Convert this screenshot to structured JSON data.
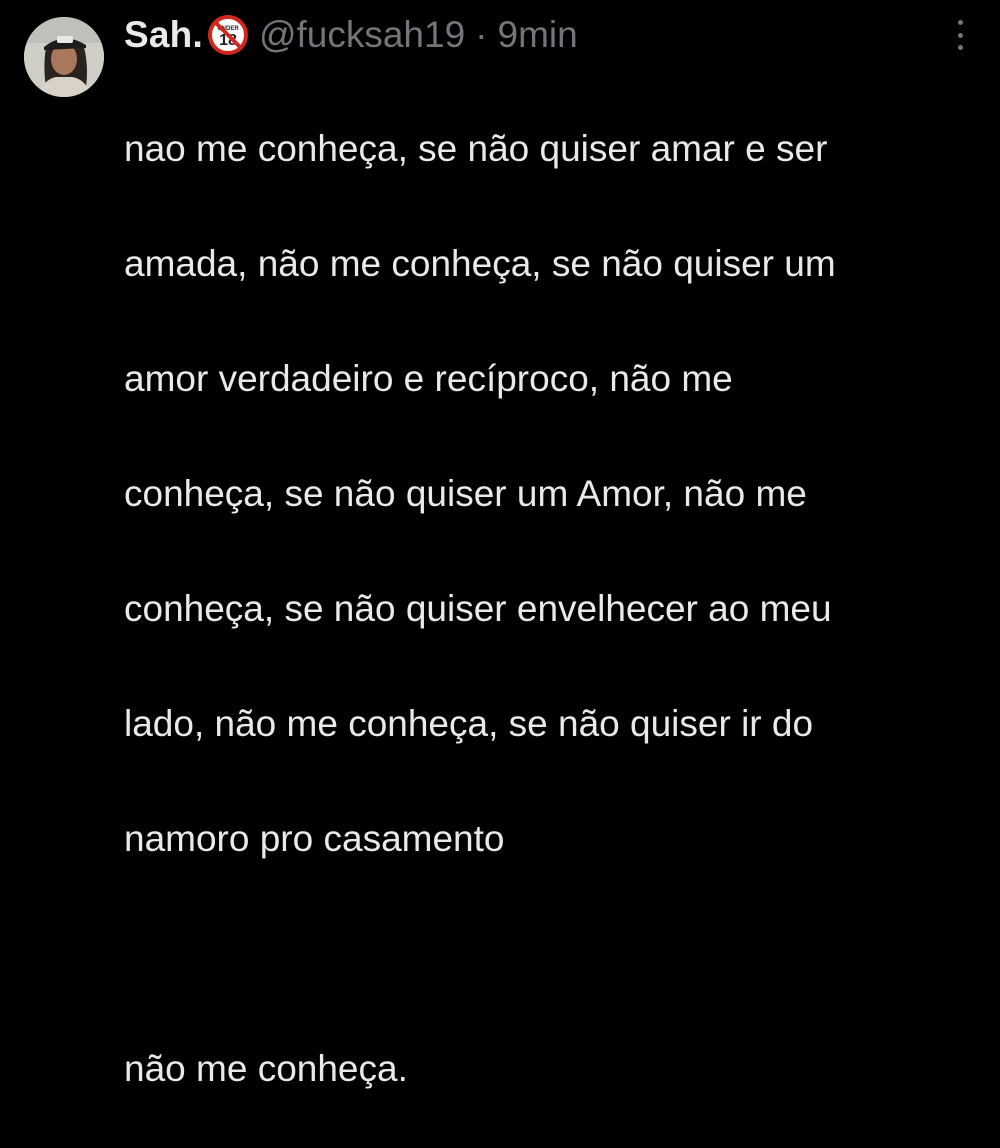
{
  "tweet": {
    "author": {
      "display_name": "Sah.",
      "badge_icon": "under-18-icon",
      "badge_text": "UNDER",
      "badge_number": "18",
      "handle": "@fucksah19",
      "separator": "·",
      "time": "9min",
      "avatar_icon": "profile-photo"
    },
    "more_icon": "more-vertical-icon",
    "text_lines": [
      "nao me conheça, se não quiser amar e ser",
      "amada, não me conheça, se não quiser um",
      "amor verdadeiro e recíproco, não me",
      "conheça, se não quiser um Amor, não me",
      "conheça, se não quiser envelhecer ao meu",
      "lado, não me conheça, se não quiser ir do",
      "namoro pro casamento"
    ],
    "closing_line": "não me conheça."
  },
  "colors": {
    "background": "#000000",
    "primary_text": "#e7e9ea",
    "secondary_text": "#71767b",
    "badge_red": "#d0281f"
  }
}
